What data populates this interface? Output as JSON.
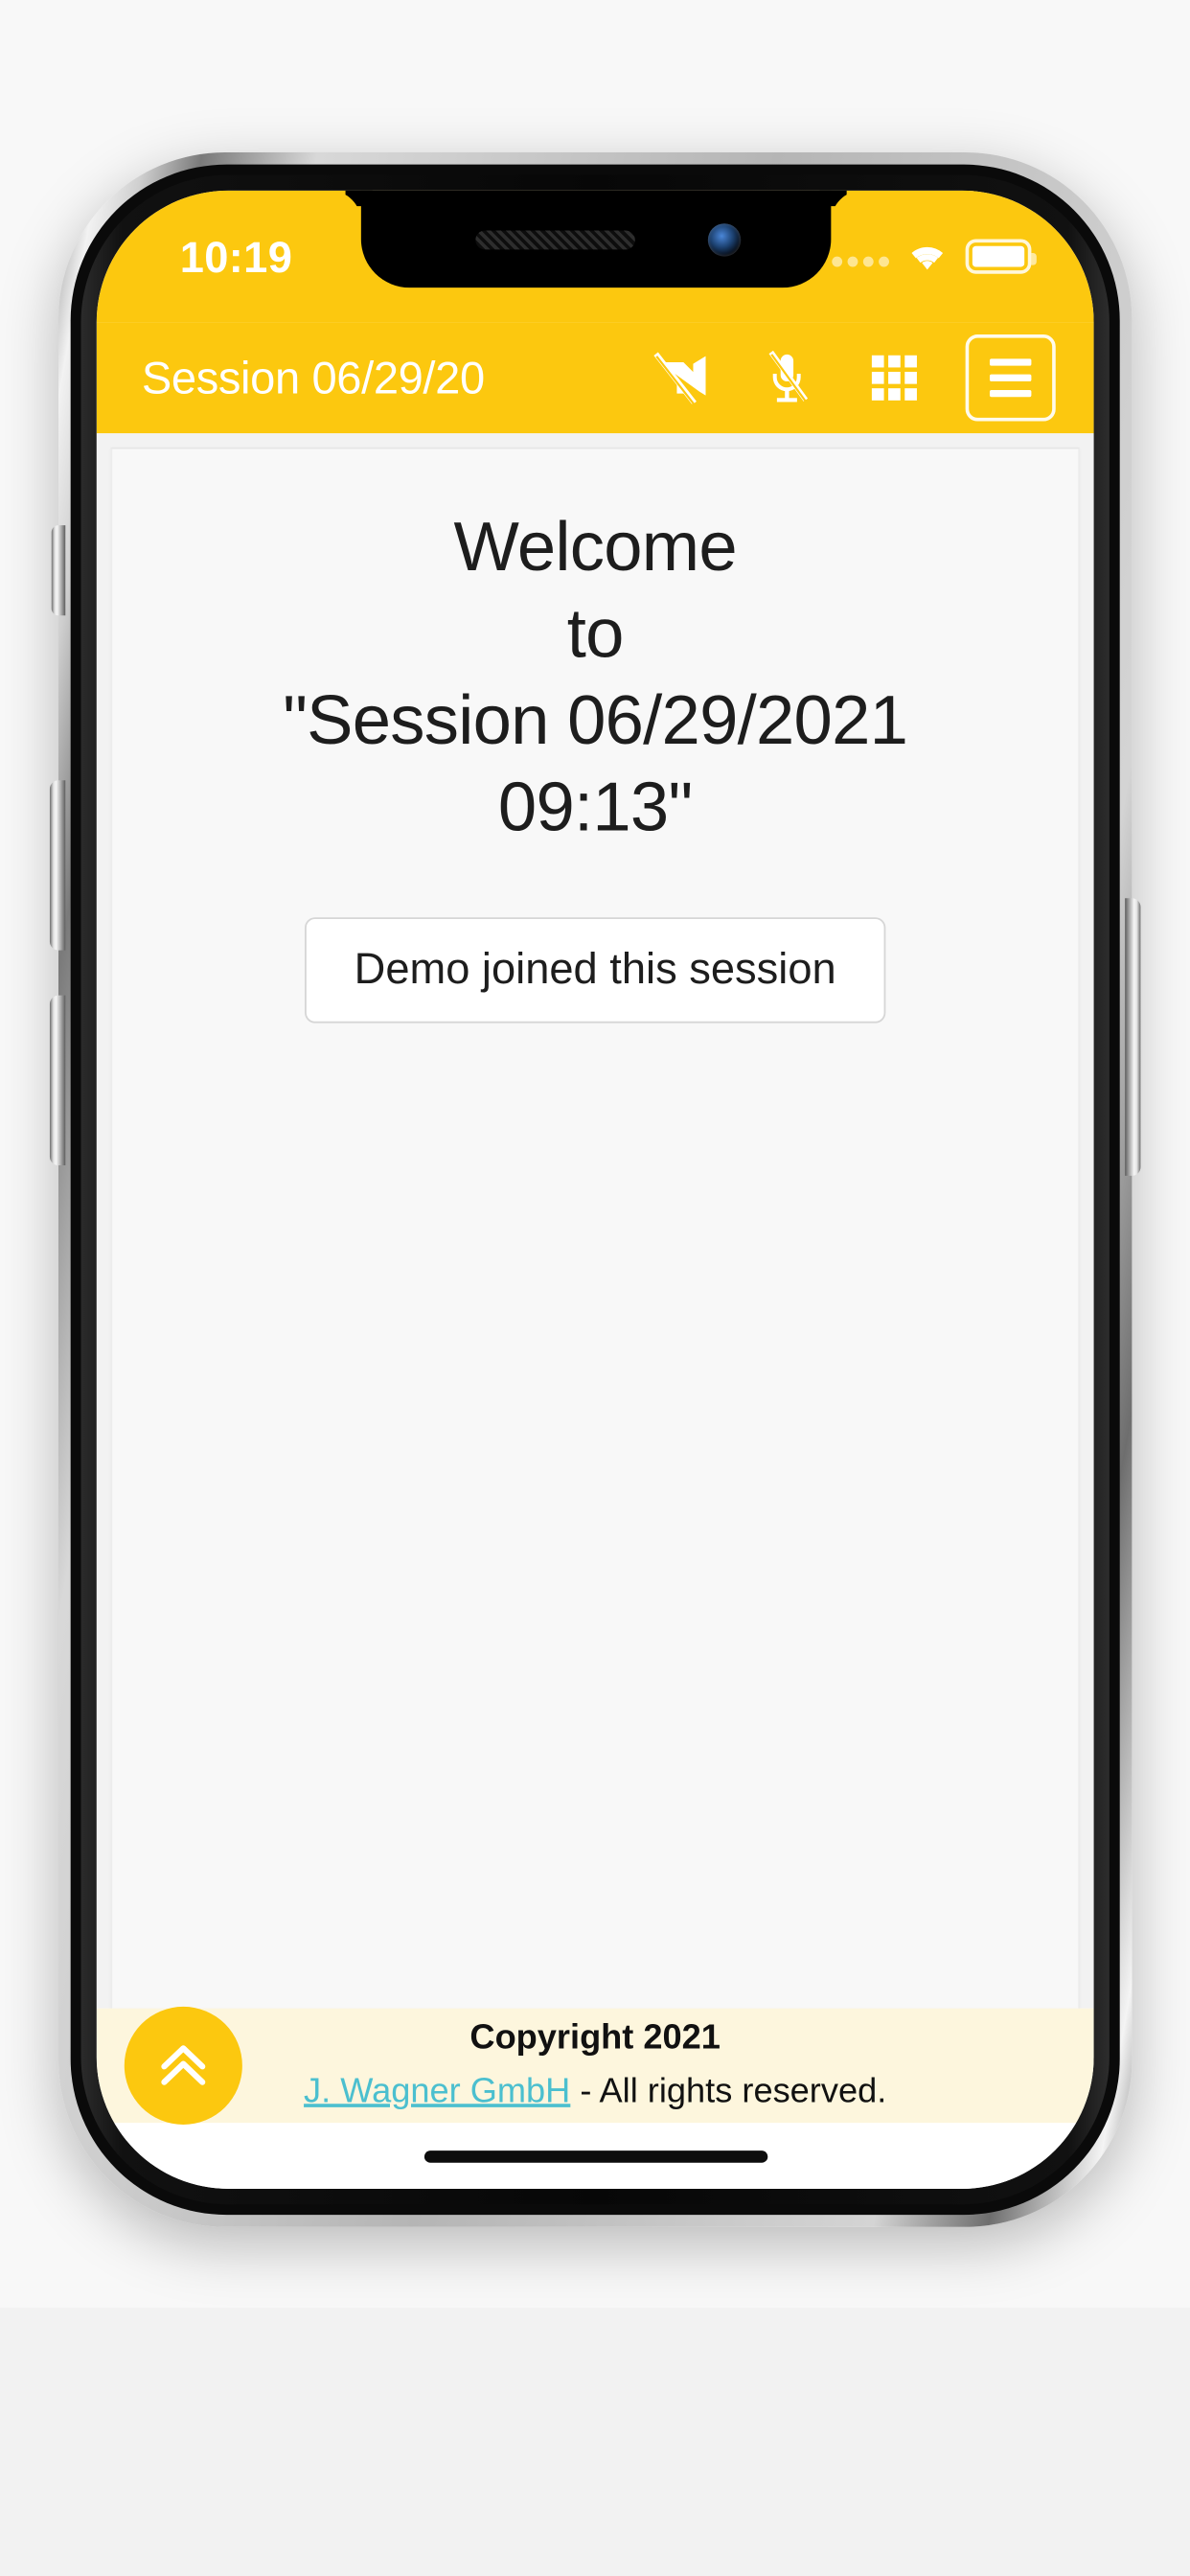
{
  "device": {
    "type": "smartphone-mockup",
    "frame_color": "#b5b5b5"
  },
  "status_bar": {
    "time": "10:19",
    "wifi_icon": "wifi-icon",
    "battery_icon": "battery-full-icon",
    "signal_icon": "signal-dots-icon",
    "background": "#fcc80f",
    "text_color": "#ffffff"
  },
  "header": {
    "title": "Session 06/29/20",
    "background": "#fcc80f",
    "actions": [
      {
        "name": "video-off-icon",
        "label": "Camera off"
      },
      {
        "name": "mic-off-icon",
        "label": "Microphone off"
      },
      {
        "name": "grid-view-icon",
        "label": "Grid view"
      }
    ],
    "menu_button": {
      "name": "hamburger-menu-icon",
      "label": "Menu"
    }
  },
  "content": {
    "welcome_line1": "Welcome",
    "welcome_line2": "to",
    "welcome_line3": "\"Session 06/29/2021",
    "welcome_line4": "09:13\"",
    "join_notice": "Demo joined this session",
    "card_background": "#f8f8f8"
  },
  "footer": {
    "copyright": "Copyright 2021",
    "company": "J. Wagner GmbH",
    "rights": " - All rights reserved.",
    "background": "#fdf6dd",
    "link_color": "#4bbfcf",
    "scroll_top_button": {
      "name": "scroll-to-top-button",
      "icon": "double-chevron-up-icon",
      "color": "#fcc80f"
    }
  }
}
